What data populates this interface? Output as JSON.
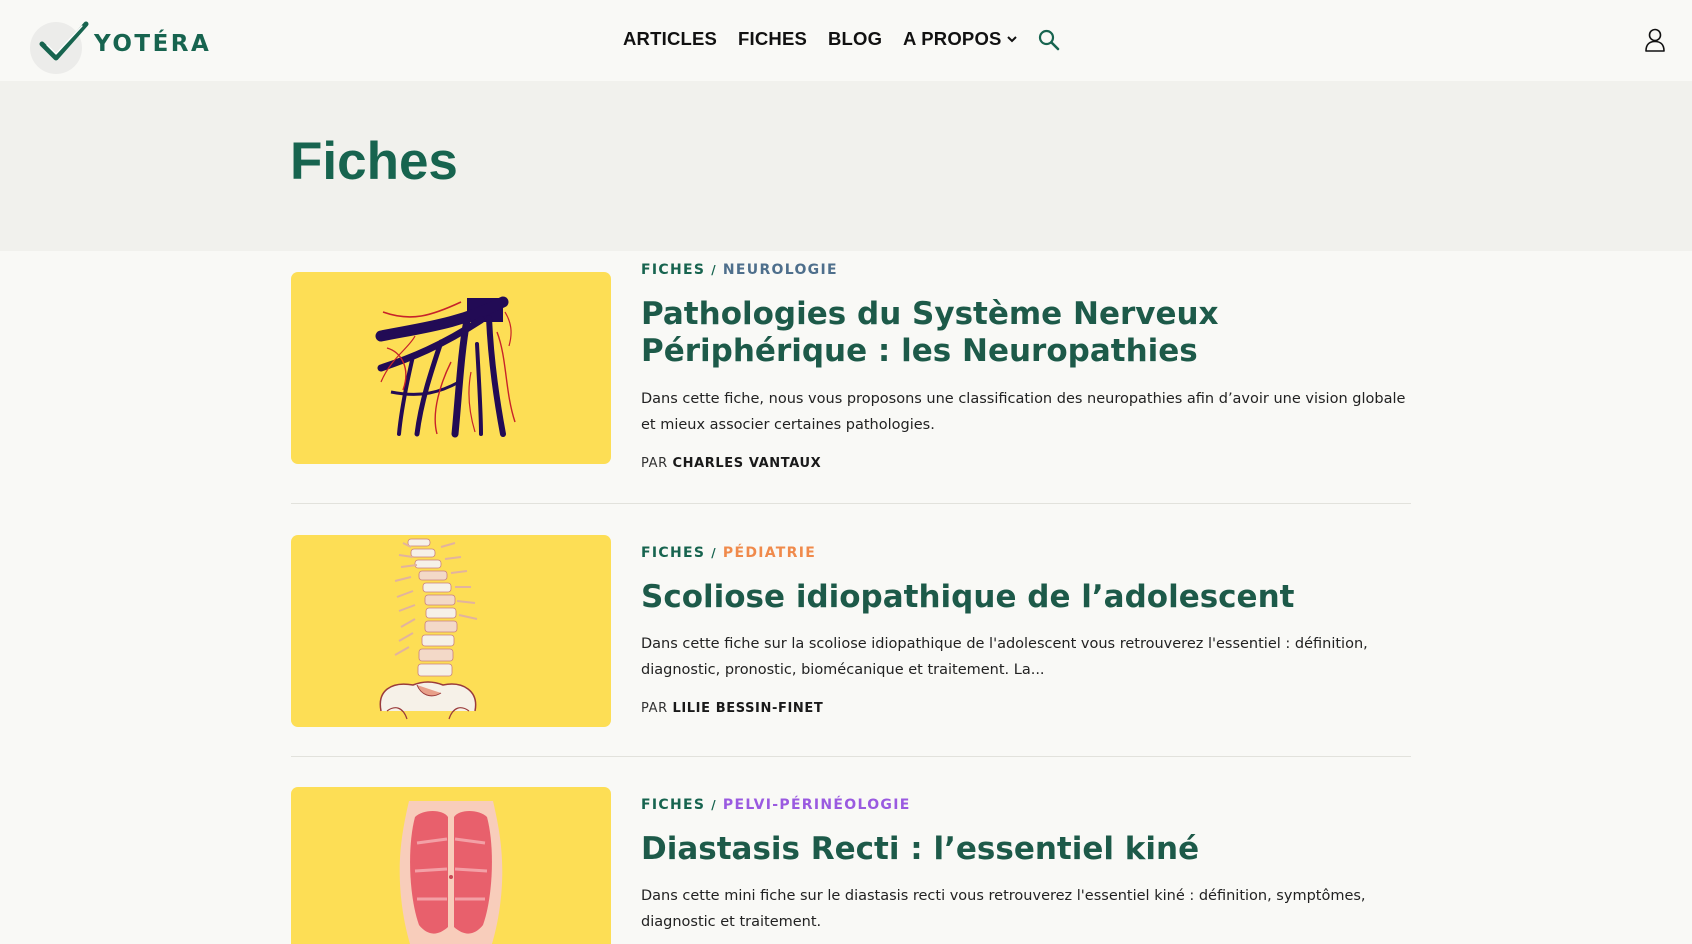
{
  "brand": {
    "name": "YOTÉRA",
    "primary_color": "#17644f",
    "accent_yellow": "#fdde55"
  },
  "nav": {
    "items": [
      {
        "label": "ARTICLES"
      },
      {
        "label": "FICHES"
      },
      {
        "label": "BLOG"
      },
      {
        "label": "A PROPOS"
      }
    ],
    "search_icon": "search-icon",
    "account_icon": "user-icon"
  },
  "page": {
    "title": "Fiches"
  },
  "articles": [
    {
      "section": "FICHES",
      "separator": "/",
      "category": "NEUROLOGIE",
      "category_color": "#4e6f8c",
      "title": "Pathologies du Système Nerveux Périphérique : les Neuropathies",
      "excerpt": "Dans cette fiche, nous vous proposons une classification des neuropathies afin d’avoir une vision globale et mieux associer certaines pathologies.",
      "by": "PAR",
      "author": "CHARLES VANTAUX",
      "image": "nerves-illustration"
    },
    {
      "section": "FICHES",
      "separator": "/",
      "category": "PÉDIATRIE",
      "category_color": "#f08a4b",
      "title": "Scoliose idiopathique de l’adolescent",
      "excerpt": "Dans cette fiche sur la scoliose idiopathique de l'adolescent vous retrouverez l'essentiel : définition, diagnostic, pronostic, biomécanique et traitement. La...",
      "by": "PAR",
      "author": "LILIE BESSIN-FINET",
      "image": "spine-illustration"
    },
    {
      "section": "FICHES",
      "separator": "/",
      "category": "PELVI-PÉRINÉOLOGIE",
      "category_color": "#9a5ae0",
      "title": "Diastasis Recti : l’essentiel kiné",
      "excerpt": "Dans cette mini fiche sur le diastasis recti vous retrouverez l'essentiel kiné : définition, symptômes, diagnostic et traitement.",
      "image": "abdominal-muscles-illustration"
    }
  ]
}
